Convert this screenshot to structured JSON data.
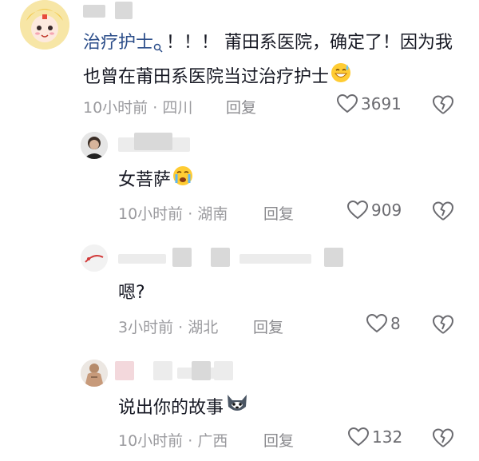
{
  "comments": [
    {
      "author": "治疗护士",
      "author_icon": "search-icon",
      "text": "！！！ 莆田系医院，确定了！因为我也曾在莆田系医院当过治疗护士",
      "emoji": "sweat-smile-icon",
      "time": "10小时前",
      "location": "四川",
      "reply_label": "回复",
      "likes": "3691"
    },
    {
      "text": "女菩萨",
      "emoji": "crying-icon",
      "time": "10小时前",
      "location": "湖南",
      "reply_label": "回复",
      "likes": "909"
    },
    {
      "text": "嗯?",
      "time": "3小时前",
      "location": "湖北",
      "reply_label": "回复",
      "likes": "8"
    },
    {
      "text": "说出你的故事",
      "emoji": "husky-icon",
      "time": "10小时前",
      "location": "广西",
      "reply_label": "回复",
      "likes": "132"
    }
  ],
  "separator": "·",
  "colors": {
    "author": "#2c4e8a",
    "meta": "#9a9a9e",
    "icon": "#6b6b70"
  }
}
